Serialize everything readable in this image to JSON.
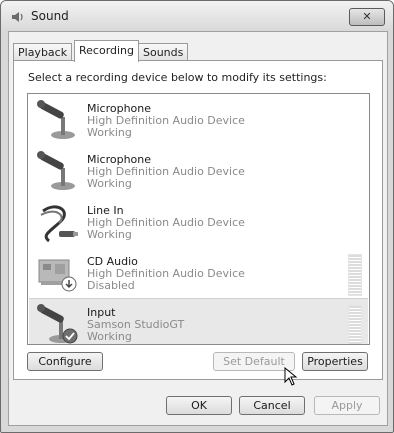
{
  "window": {
    "title": "Sound",
    "close_label": "✕"
  },
  "tabs": [
    {
      "label": "Playback",
      "active": false
    },
    {
      "label": "Recording",
      "active": true
    },
    {
      "label": "Sounds",
      "active": false
    }
  ],
  "instruction": "Select a recording device below to modify its settings:",
  "devices": [
    {
      "name": "Microphone",
      "description": "High Definition Audio Device",
      "status": "Working",
      "icon": "microphone-icon",
      "selected": false
    },
    {
      "name": "Microphone",
      "description": "High Definition Audio Device",
      "status": "Working",
      "icon": "microphone-icon",
      "selected": false
    },
    {
      "name": "Line In",
      "description": "High Definition Audio Device",
      "status": "Working",
      "icon": "audio-cable-icon",
      "selected": false
    },
    {
      "name": "CD Audio",
      "description": "High Definition Audio Device",
      "status": "Disabled",
      "icon": "sound-card-disabled-icon",
      "selected": false
    },
    {
      "name": "Input",
      "description": "Samson StudioGT",
      "status": "Working",
      "icon": "microphone-default-check-icon",
      "selected": true
    }
  ],
  "buttons": {
    "configure": "Configure",
    "set_default": "Set Default",
    "properties": "Properties",
    "ok": "OK",
    "cancel": "Cancel",
    "apply": "Apply"
  },
  "colors": {
    "selected_row": "#e8e8e8",
    "disabled_text": "#9a9a9a",
    "accent_check": "#3c7a3c"
  }
}
